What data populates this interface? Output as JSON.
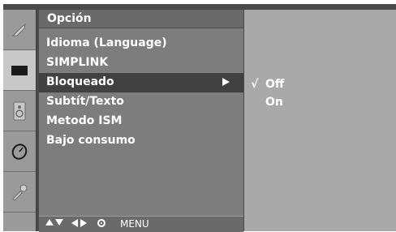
{
  "menu": {
    "title": "Opción",
    "items": [
      {
        "label": "Idioma (Language)"
      },
      {
        "label": "SIMPLINK"
      },
      {
        "label": "Bloqueado"
      },
      {
        "label": "Subtít/Texto"
      },
      {
        "label": "Metodo ISM"
      },
      {
        "label": "Bajo consumo"
      }
    ],
    "selected_index": 2
  },
  "submenu": {
    "items": [
      {
        "label": "Off",
        "checked": true
      },
      {
        "label": "On",
        "checked": false
      }
    ],
    "check_glyph": "√"
  },
  "nav_bar": {
    "menu_label": "MENU"
  },
  "icons": [
    "picture-icon",
    "screen-icon",
    "speaker-icon",
    "clock-icon",
    "tools-icon"
  ],
  "colors": {
    "panel": "#7d7d7d",
    "selected_row": "#414141",
    "submenu_panel": "#a9a9a9",
    "text": "#ffffff"
  }
}
